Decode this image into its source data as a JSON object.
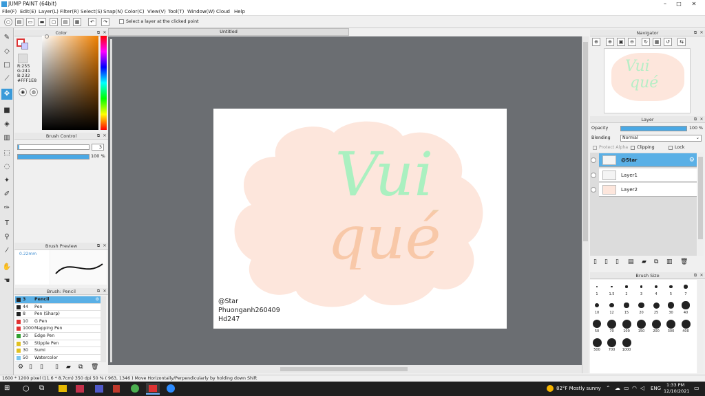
{
  "window": {
    "title": "JUMP PAINT (64bit)",
    "minimize": "–",
    "maximize": "□",
    "close": "✕"
  },
  "menu": [
    "File(F)",
    "Edit(E)",
    "Layer(L)",
    "Filter(R)",
    "Select(S)",
    "Snap(N)",
    "Color(C)",
    "View(V)",
    "Tool(T)",
    "Window(W)",
    "Cloud",
    "Help"
  ],
  "toolbar": {
    "option_label": "Select a layer at the clicked point"
  },
  "color_panel": {
    "title": "Color",
    "r": "R:255",
    "g": "G:241",
    "b": "B:232",
    "hex": "#FFF1E8"
  },
  "brush_control": {
    "title": "Brush Control",
    "size": "3",
    "opacity": "100 %"
  },
  "brush_preview": {
    "title": "Brush Preview",
    "size_label": "0.22mm"
  },
  "brush_list": {
    "title": "Brush: Pencil",
    "items": [
      {
        "size": "3",
        "name": "Pencil",
        "color": "#222",
        "selected": true
      },
      {
        "size": "44",
        "name": "Pen",
        "color": "#222"
      },
      {
        "size": "8",
        "name": "Pen (Sharp)",
        "color": "#222"
      },
      {
        "size": "10",
        "name": "G Pen",
        "color": "#e03030"
      },
      {
        "size": "1000",
        "name": "Mapping Pen",
        "color": "#e03030"
      },
      {
        "size": "20",
        "name": "Edge Pen",
        "color": "#30a030"
      },
      {
        "size": "50",
        "name": "Stipple Pen",
        "color": "#e0c020"
      },
      {
        "size": "30",
        "name": "Sumi",
        "color": "#e0c020"
      },
      {
        "size": "50",
        "name": "Watercolor",
        "color": "#7ac6f0"
      }
    ]
  },
  "document": {
    "tab": "Untitled",
    "canvas_text": "Vui\nqué",
    "caption_lines": [
      "@Star",
      "Phuonganh260409",
      "Hd247"
    ]
  },
  "navigator": {
    "title": "Navigator"
  },
  "layer_panel": {
    "title": "Layer",
    "opacity_label": "Opacity",
    "opacity_value": "100 %",
    "blending_label": "Blending",
    "blending_value": "Normal",
    "protect_alpha": "Protect Alpha",
    "clipping": "Clipping",
    "lock": "Lock",
    "layers": [
      {
        "name": "@Star",
        "selected": true
      },
      {
        "name": "Layer1"
      },
      {
        "name": "Layer2"
      }
    ]
  },
  "brush_size": {
    "title": "Brush Size",
    "sizes": [
      "1",
      "1.5",
      "2",
      "3",
      "4",
      "5",
      "7",
      "10",
      "12",
      "15",
      "20",
      "25",
      "30",
      "40",
      "50",
      "70",
      "100",
      "150",
      "200",
      "300",
      "400",
      "500",
      "700",
      "1000"
    ]
  },
  "status": {
    "text": "1600 * 1200 pixel  (11.6 * 8.7cm)  350 dpi  50 %  ( 963, 1346 )  Move Horizontally/Perpendicularly by holding down Shift"
  },
  "taskbar": {
    "weather": "82°F  Mostly sunny",
    "lang": "ENG",
    "time": "1:33 PM",
    "date": "12/10/2021"
  }
}
